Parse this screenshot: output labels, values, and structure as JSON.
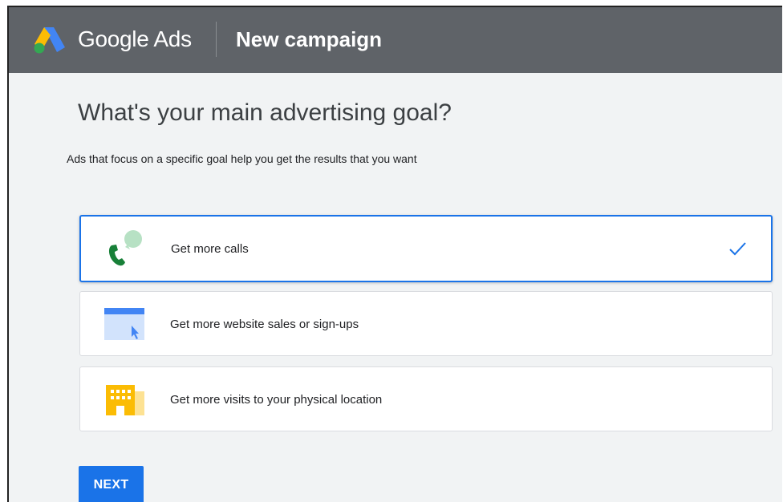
{
  "header": {
    "brand": "Google Ads",
    "page_title": "New campaign",
    "logo_icon": "google-ads-logo-icon"
  },
  "main": {
    "title": "What's your main advertising goal?",
    "subtitle": "Ads that focus on a specific goal help you get the results that you want",
    "goals": [
      {
        "label": "Get more calls",
        "icon": "phone-call-icon",
        "selected": true
      },
      {
        "label": "Get more website sales or sign-ups",
        "icon": "website-cursor-icon",
        "selected": false
      },
      {
        "label": "Get more visits to your physical location",
        "icon": "building-icon",
        "selected": false
      }
    ],
    "next_label": "NEXT"
  },
  "colors": {
    "topbar": "#5f6368",
    "background": "#f1f3f4",
    "accent": "#1a73e8",
    "ads_blue": "#4285f4",
    "ads_yellow": "#fbbc04",
    "ads_green": "#34a853"
  }
}
